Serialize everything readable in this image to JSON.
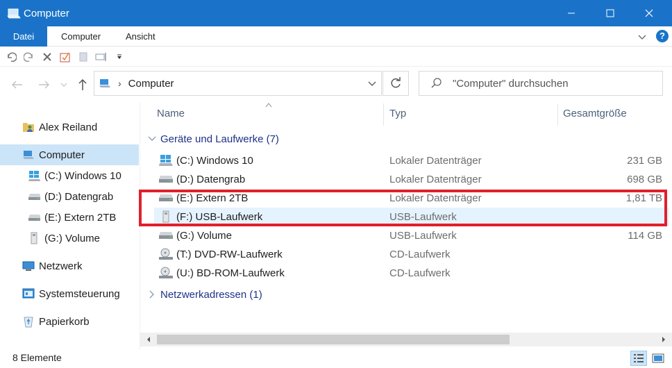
{
  "window": {
    "title": "Computer",
    "accent": "#1a73c8"
  },
  "ribbon": {
    "tabs": [
      {
        "label": "Datei"
      },
      {
        "label": "Computer"
      },
      {
        "label": "Ansicht"
      }
    ]
  },
  "address": {
    "crumb": "Computer"
  },
  "search": {
    "placeholder": "\"Computer\" durchsuchen"
  },
  "sidebar": {
    "items": [
      {
        "label": "Alex Reiland",
        "icon": "user-folder-icon"
      },
      {
        "label": "Computer",
        "icon": "computer-icon",
        "selected": true
      },
      {
        "label": "(C:) Windows 10",
        "icon": "windows-drive-icon"
      },
      {
        "label": "(D:) Datengrab",
        "icon": "drive-icon"
      },
      {
        "label": "(E:) Extern 2TB",
        "icon": "drive-icon"
      },
      {
        "label": "(G:) Volume",
        "icon": "usb-drive-icon"
      },
      {
        "label": "Netzwerk",
        "icon": "network-icon"
      },
      {
        "label": "Systemsteuerung",
        "icon": "control-panel-icon"
      },
      {
        "label": "Papierkorb",
        "icon": "recycle-bin-icon"
      }
    ]
  },
  "columns": {
    "name": "Name",
    "type": "Typ",
    "size": "Gesamtgröße"
  },
  "groups": {
    "devices": "Geräte und Laufwerke (7)",
    "network": "Netzwerkadressen (1)"
  },
  "drives": [
    {
      "name": "(C:) Windows 10",
      "type": "Lokaler Datenträger",
      "size": "231 GB",
      "icon": "windows-drive-icon"
    },
    {
      "name": "(D:) Datengrab",
      "type": "Lokaler Datenträger",
      "size": "698 GB",
      "icon": "drive-icon"
    },
    {
      "name": "(E:) Extern 2TB",
      "type": "Lokaler Datenträger",
      "size": "1,81 TB",
      "icon": "drive-icon"
    },
    {
      "name": "(F:) USB-Laufwerk",
      "type": "USB-Laufwerk",
      "size": "",
      "icon": "usb-drive-icon",
      "selected": true
    },
    {
      "name": "(G:) Volume",
      "type": "USB-Laufwerk",
      "size": "114 GB",
      "icon": "usb-drive-icon"
    },
    {
      "name": "(T:) DVD-RW-Laufwerk",
      "type": "CD-Laufwerk",
      "size": "",
      "icon": "cd-drive-icon"
    },
    {
      "name": "(U:) BD-ROM-Laufwerk",
      "type": "CD-Laufwerk",
      "size": "",
      "icon": "cd-drive-icon"
    }
  ],
  "status": {
    "count": "8 Elemente"
  },
  "colors": {
    "highlight": "#e0202b",
    "selection": "#cce4f7"
  }
}
